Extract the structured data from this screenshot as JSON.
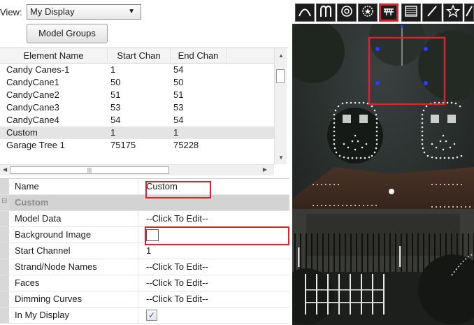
{
  "view": {
    "label": "View:",
    "selected": "My Display",
    "model_groups_button": "Model Groups"
  },
  "table": {
    "columns": [
      "Element Name",
      "Start Chan",
      "End Chan"
    ],
    "rows": [
      {
        "name": "Candy Canes-1",
        "start": "1",
        "end": "54"
      },
      {
        "name": "CandyCane1",
        "start": "50",
        "end": "50"
      },
      {
        "name": "CandyCane2",
        "start": "51",
        "end": "51"
      },
      {
        "name": "CandyCane3",
        "start": "53",
        "end": "53"
      },
      {
        "name": "CandyCane4",
        "start": "54",
        "end": "54"
      },
      {
        "name": "Custom",
        "start": "1",
        "end": "1"
      },
      {
        "name": "Garage Tree 1",
        "start": "75175",
        "end": "75228"
      }
    ],
    "selected_row": "Custom"
  },
  "properties": {
    "name_label": "Name",
    "name_value": "Custom",
    "category": "Custom",
    "model_data_label": "Model Data",
    "model_data_value": "--Click To Edit--",
    "background_image_label": "Background Image",
    "start_channel_label": "Start Channel",
    "start_channel_value": "1",
    "strand_node_label": "Strand/Node Names",
    "strand_node_value": "--Click To Edit--",
    "faces_label": "Faces",
    "faces_value": "--Click To Edit--",
    "dimming_label": "Dimming Curves",
    "dimming_value": "--Click To Edit--",
    "in_display_label": "In My Display",
    "in_display_checked": true
  },
  "toolbar": {
    "tools": [
      "arch-icon",
      "candy-cane-icon",
      "circle-icon",
      "star-wreath-icon",
      "custom-model-icon",
      "matrix-icon",
      "line-icon",
      "star-icon",
      "window-frame-icon"
    ],
    "selected_tool": "custom-model-icon"
  },
  "colors": {
    "highlight": "#d9232e",
    "canvas_bg": "#1b1c1b",
    "node_blue": "#2a3cff"
  }
}
